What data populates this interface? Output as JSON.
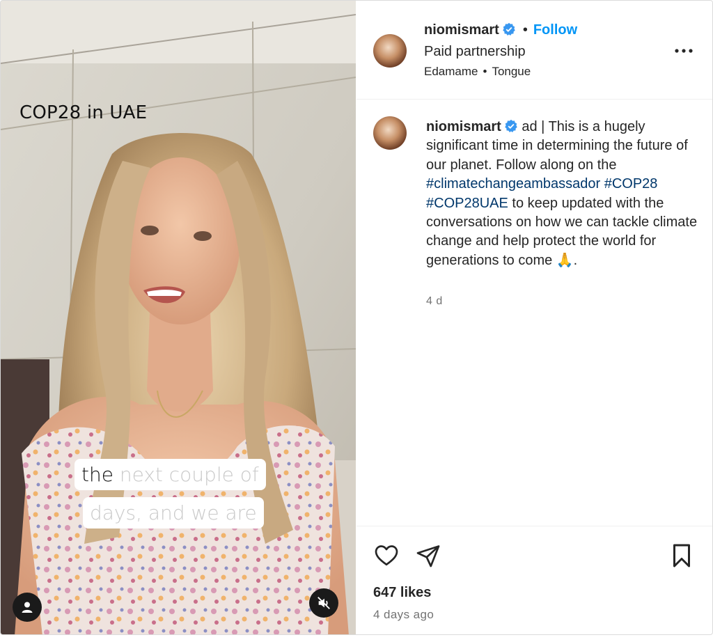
{
  "video": {
    "overlay_title": "COP28 in UAE",
    "subtitle_line1_said": "the",
    "subtitle_line1_pending": " next couple of",
    "subtitle_line2": "days, and we are",
    "user_icon": "user-icon",
    "mute_icon": "speaker-muted-icon"
  },
  "header": {
    "username": "niomismart",
    "verified_icon": "verified-badge-icon",
    "dot": "•",
    "follow_label": "Follow",
    "subtitle": "Paid partnership",
    "audio_artist": "Edamame",
    "audio_sep": "•",
    "audio_track": "Tongue",
    "more_icon": "more-options-icon"
  },
  "caption": {
    "username": "niomismart",
    "text_before": " ad | This is a hugely significant time in determining the future of our planet. Follow along on the ",
    "hashtag1": "#climatechangeambassador",
    "hashtag2": "#COP28",
    "hashtag3": "#COP28UAE",
    "text_after": " to keep updated with the conversations on how we can tackle climate change and help protect the world for generations to come 🙏.",
    "time": "4 d"
  },
  "actions": {
    "like_icon": "heart-icon",
    "share_icon": "send-icon",
    "save_icon": "bookmark-icon",
    "likes": "647 likes",
    "posted": "4 days ago"
  },
  "colors": {
    "accent": "#0095f6",
    "hashtag": "#00376b",
    "secondary_text": "#737373",
    "verified": "#3897f0"
  }
}
